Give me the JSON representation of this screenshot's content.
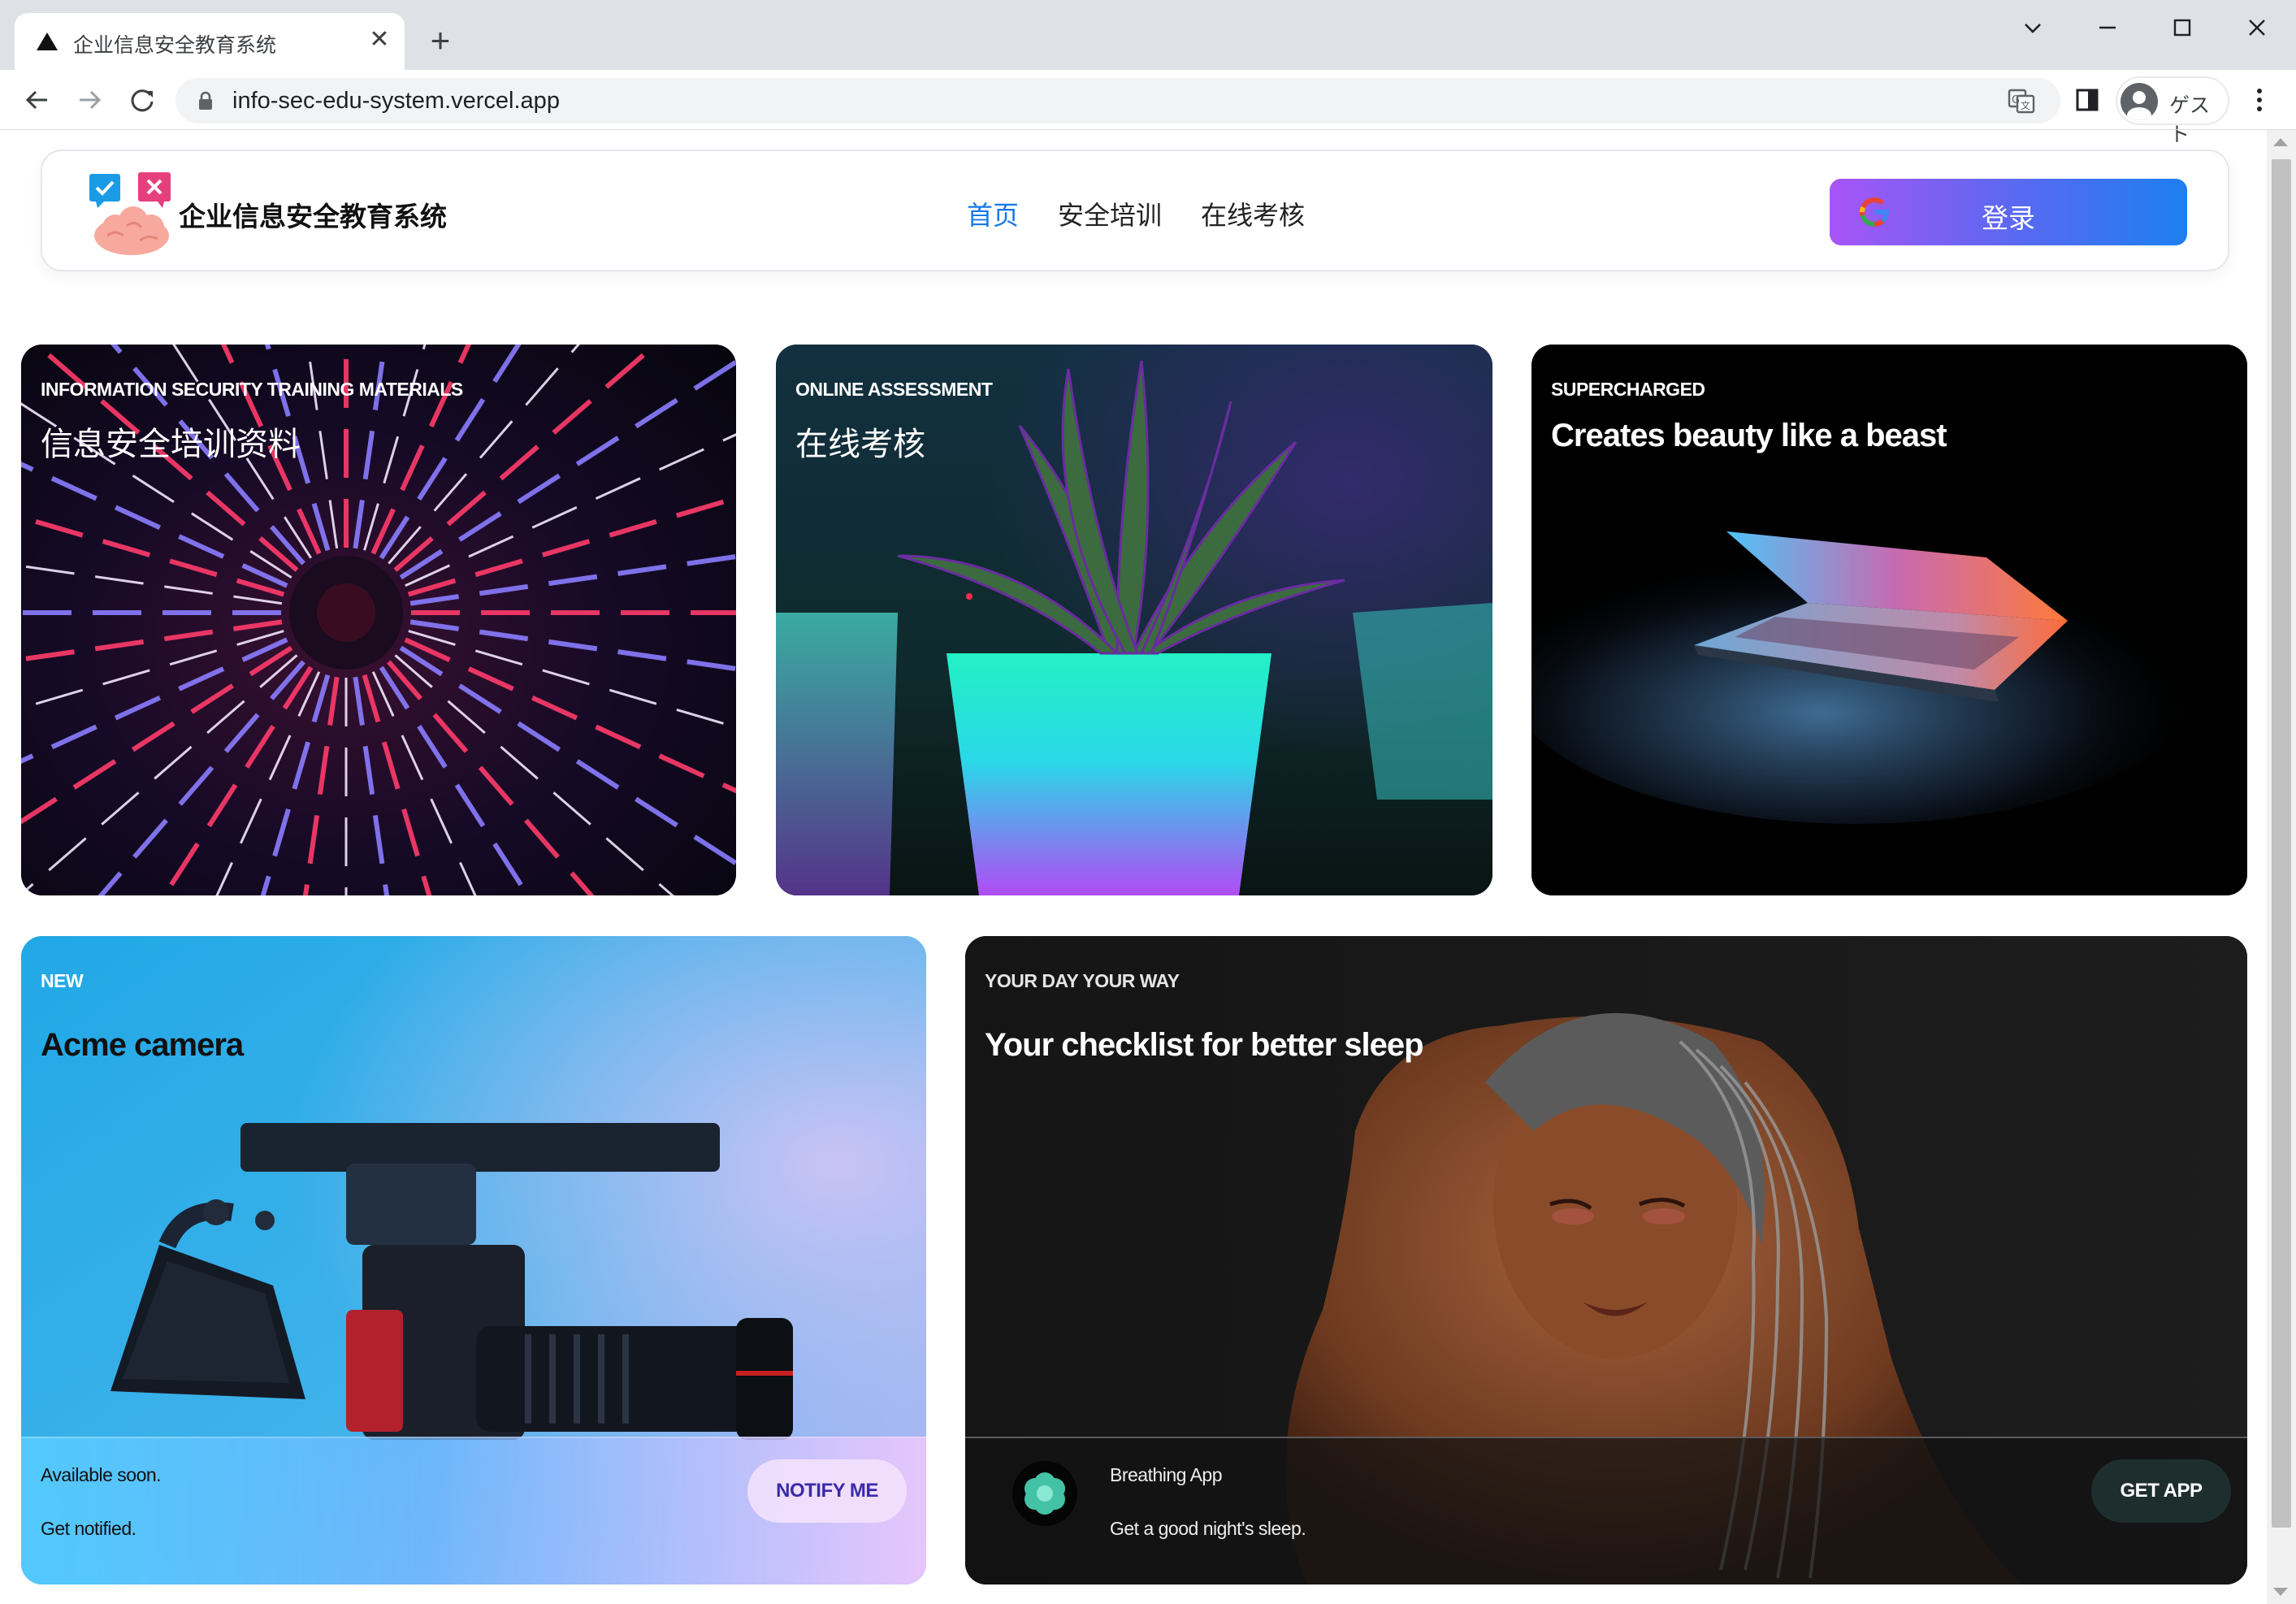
{
  "browser": {
    "tab_title": "企业信息安全教育系统",
    "url": "info-sec-edu-system.vercel.app",
    "profile_label": "ゲスト"
  },
  "header": {
    "site_title": "企业信息安全教育系统",
    "nav": [
      {
        "label": "首页",
        "active": true
      },
      {
        "label": "安全培训",
        "active": false
      },
      {
        "label": "在线考核",
        "active": false
      }
    ],
    "login_label": "登录"
  },
  "cards": [
    {
      "eyebrow": "INFORMATION SECURITY TRAINING MATERIALS",
      "headline": "信息安全培训资料"
    },
    {
      "eyebrow": "ONLINE ASSESSMENT",
      "headline": "在线考核"
    },
    {
      "eyebrow": "SUPERCHARGED",
      "headline": "Creates beauty like a beast"
    },
    {
      "eyebrow": "NEW",
      "headline": "Acme camera",
      "footer": {
        "line1": "Available soon.",
        "line2": "Get notified.",
        "button": "NOTIFY ME"
      }
    },
    {
      "eyebrow": "YOUR DAY YOUR WAY",
      "headline": "Your checklist for better sleep",
      "footer": {
        "app_name": "Breathing App",
        "app_desc": "Get a good night's sleep.",
        "button": "GET APP"
      }
    }
  ],
  "colors": {
    "accent": "#1677e6",
    "login_gradient": [
      "#a855f7",
      "#6366f1",
      "#1d7ff0"
    ],
    "tab_bar": "#dee1e6"
  }
}
